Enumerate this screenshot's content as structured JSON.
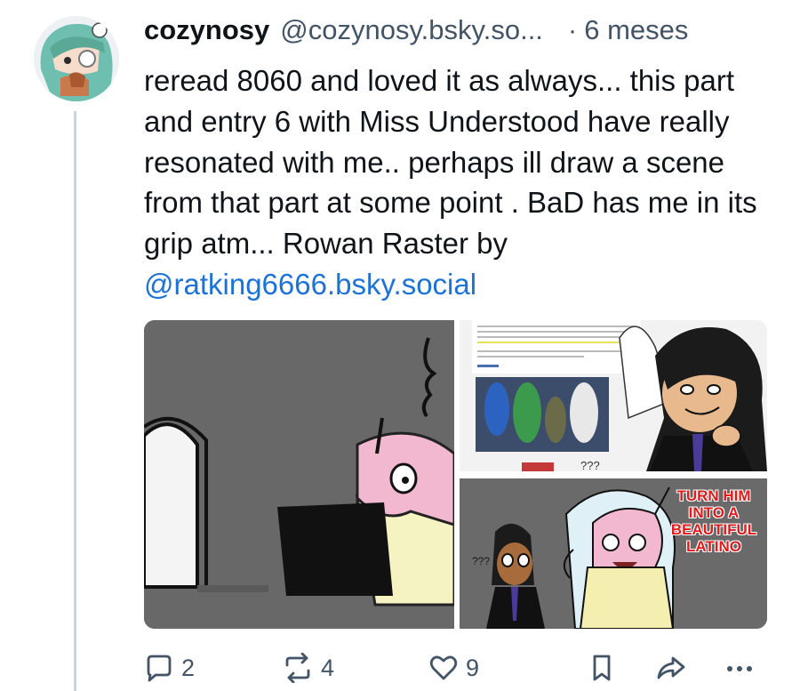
{
  "post": {
    "author": {
      "display_name": "cozynosy",
      "handle": "@cozynosy.bsky.so...",
      "avatar_icon": "avatar-image"
    },
    "separator": "·",
    "timestamp": "6 meses",
    "text": {
      "body": "reread 8060 and loved it as always... this part and entry 6 with Miss Understood have really resonated with me.. perhaps ill draw a scene from that part at some point . BaD has me in its grip atm... Rowan Raster by ",
      "mention": "@ratking6666.bsky.social"
    },
    "images": {
      "bottom_right_caption": "TURN HIM INTO A BEAUTIFUL LATINO",
      "bottom_right_question": "???",
      "top_right_question": "???"
    },
    "actions": {
      "reply_count": "2",
      "repost_count": "4",
      "like_count": "9"
    }
  },
  "colors": {
    "text": "#0f1419",
    "muted": "#425466",
    "link": "#1d72d8",
    "thread_line": "#c9d3dd",
    "caption_red": "#e01b1b"
  }
}
